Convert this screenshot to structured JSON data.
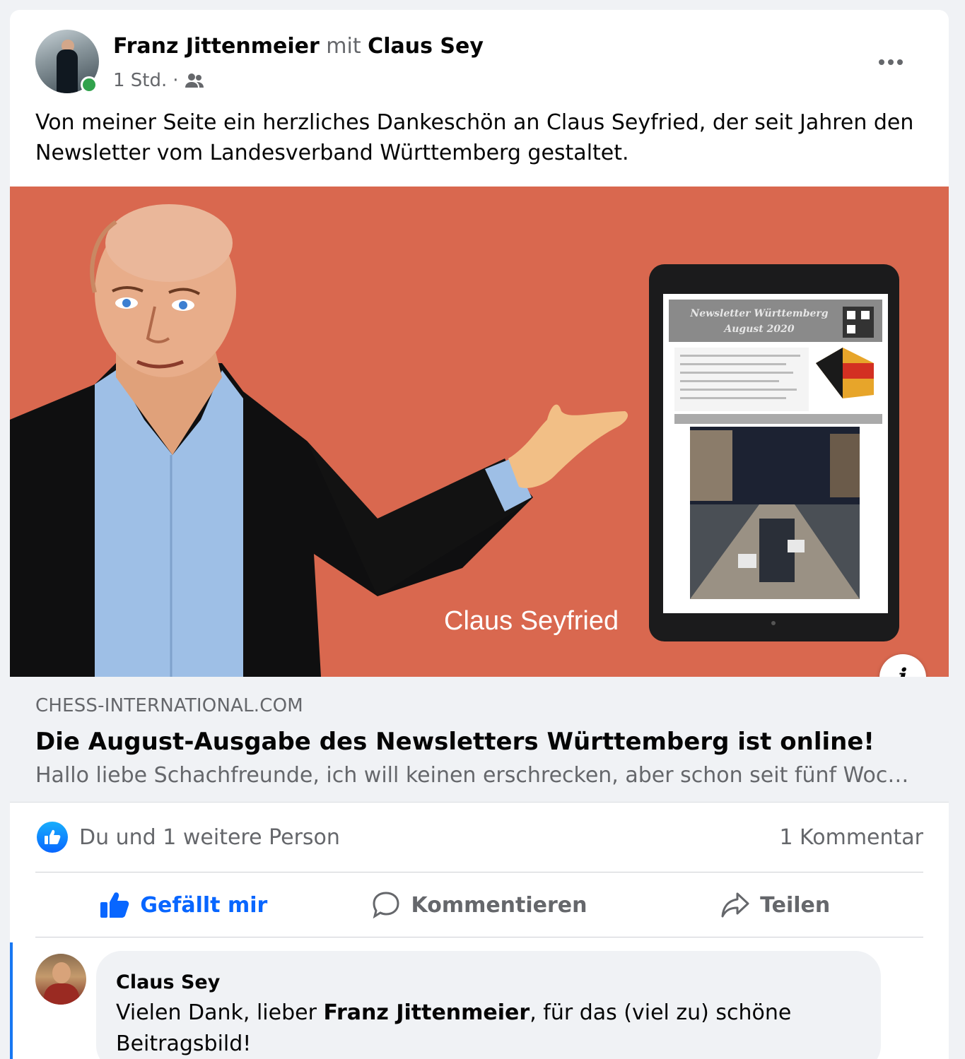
{
  "post": {
    "author": "Franz Jittenmeier",
    "with_word": "mit",
    "tagged": "Claus Sey",
    "time": "1 Std.",
    "separator": "·",
    "audience_icon": "friends-icon",
    "more_icon": "more-options-icon",
    "text": "Von meiner Seite ein herzliches Dankeschön an Claus Seyfried, der seit Jahren den Newsletter vom Landesverband Württemberg gestaltet."
  },
  "link": {
    "image_caption": "Claus Seyfried",
    "tablet": {
      "title_line1": "Newsletter Württemberg",
      "title_line2": "August 2020"
    },
    "info_icon": "i",
    "domain": "CHESS-INTERNATIONAL.COM",
    "title": "Die August-Ausgabe des Newsletters Württemberg ist online!",
    "description": "Hallo liebe Schachfreunde, ich will keinen erschrecken, aber schon seit fünf Woch..."
  },
  "stats": {
    "reactions": "Du und 1 weitere Person",
    "comments": "1 Kommentar"
  },
  "actions": {
    "like": "Gefällt mir",
    "comment": "Kommentieren",
    "share": "Teilen"
  },
  "comment": {
    "author": "Claus Sey",
    "text_before": "Vielen Dank, lieber ",
    "mention": "Franz Jittenmeier",
    "text_after": ", für das (viel zu) schöne Beitragsbild!"
  },
  "colors": {
    "accent": "#0866ff",
    "image_bg": "#d9684f",
    "secondary_text": "#65676b",
    "online": "#31a24c"
  }
}
